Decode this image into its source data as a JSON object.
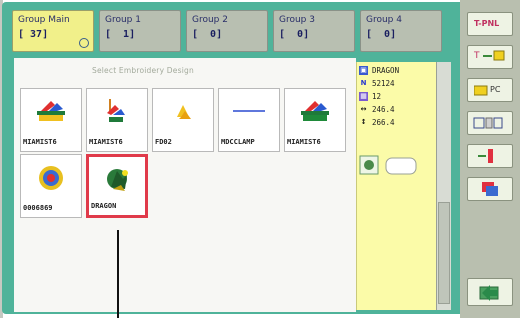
{
  "group_tabs": [
    {
      "name": "Group Main",
      "count": "[ 37]",
      "active": true
    },
    {
      "name": "Group  1",
      "count": "[  1]",
      "active": false
    },
    {
      "name": "Group 2",
      "count": "[  0]",
      "active": false
    },
    {
      "name": "Group 3",
      "count": "[  0]",
      "active": false
    },
    {
      "name": "Group 4",
      "count": "[  0]",
      "active": false
    }
  ],
  "hint_text": "Select Embroidery Design",
  "designs": [
    {
      "label": "MIAMIST6",
      "icon": "embroidery-design-icon"
    },
    {
      "label": "MIAMIST6",
      "icon": "embroidery-design-icon"
    },
    {
      "label": "FD02",
      "icon": "embroidery-design-icon"
    },
    {
      "label": "MDCCLAMP",
      "icon": "embroidery-design-icon"
    },
    {
      "label": "MIAMIST6",
      "icon": "embroidery-design-icon"
    },
    {
      "label": "0006869",
      "icon": "embroidery-design-icon"
    },
    {
      "label": "DRAGON",
      "icon": "embroidery-design-icon",
      "selected": true
    }
  ],
  "info": {
    "design_name": "DRAGON",
    "stitches": "52124",
    "colors": "12",
    "width": "246.4",
    "height": "266.4"
  },
  "right_buttons": [
    {
      "label": "T-PNL",
      "icon": "keypad-icon"
    },
    {
      "label": "",
      "icon": "move-icon"
    },
    {
      "label": "PC",
      "icon": "pc-folder-icon"
    },
    {
      "label": "",
      "icon": "usb-icon"
    },
    {
      "label": "",
      "icon": "delete-icon"
    },
    {
      "label": "",
      "icon": "copy-icon"
    },
    {
      "label": "",
      "icon": "return-icon"
    }
  ],
  "colors": {
    "frame": "#4fb39a",
    "active_tab": "#f1f08a",
    "selected_border": "#e03a4a",
    "info_bg": "#fbfba8"
  }
}
